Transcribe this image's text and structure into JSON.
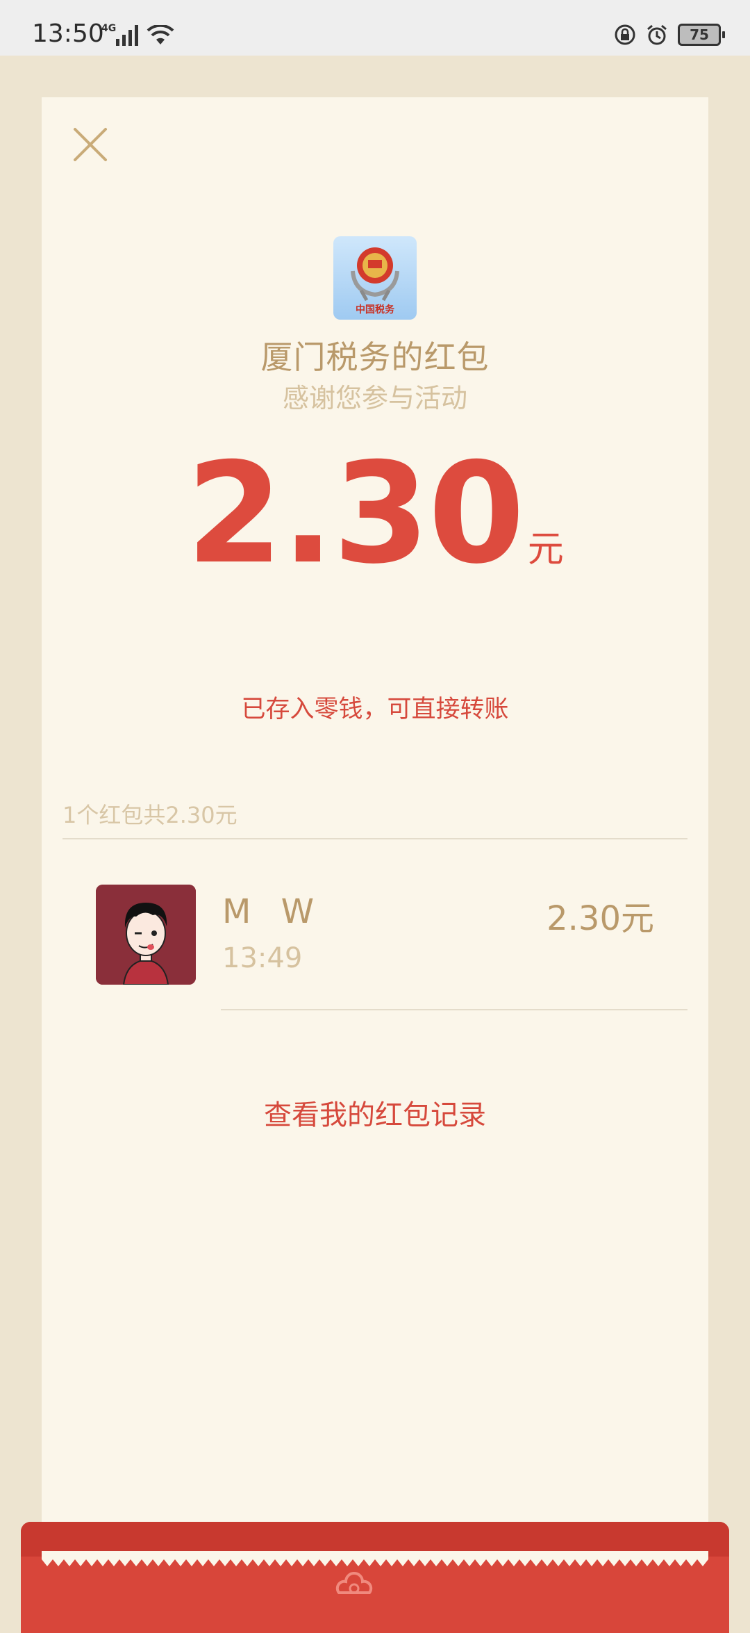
{
  "status_bar": {
    "time": "13:50",
    "network": "4G",
    "battery": "75",
    "icons": [
      "signal-icon",
      "wifi-icon",
      "rotation-lock-icon",
      "alarm-icon",
      "battery-icon"
    ]
  },
  "header": {
    "title": "厦门税务的红包",
    "subtitle": "感谢您参与活动"
  },
  "amount": {
    "value": "2.30",
    "unit": "元",
    "note": "已存入零钱，可直接转账"
  },
  "summary": "1个红包共2.30元",
  "receivers": [
    {
      "name": "M W",
      "time": "13:49",
      "amount": "2.30元"
    }
  ],
  "record_link": "查看我的红包记录",
  "logo_text": "中国税务",
  "colors": {
    "card_bg": "#fbf6ea",
    "page_bg": "#ede4d0",
    "gold": "#b9996a",
    "light_gold": "#d6c29f",
    "red": "#dd4b3e",
    "envelope_red": "#d8463a"
  }
}
